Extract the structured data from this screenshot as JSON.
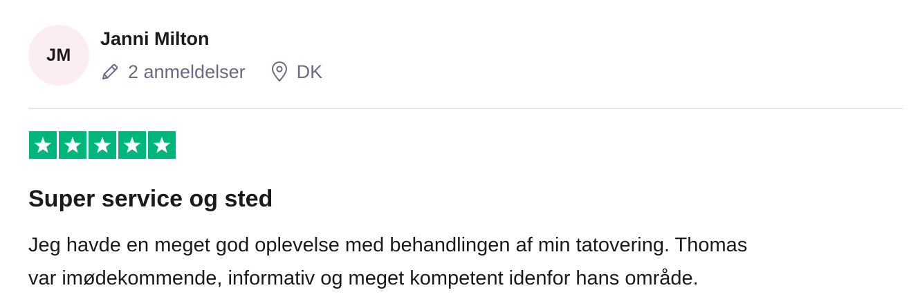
{
  "reviewer": {
    "initials": "JM",
    "name": "Janni Milton",
    "reviews_count": "2 anmeldelser",
    "country": "DK"
  },
  "rating": {
    "stars": 5,
    "max": 5,
    "color": "#00b67a"
  },
  "review": {
    "title": "Super service og sted",
    "body_lines": [
      "Jeg havde en meget god oplevelse med behandlingen af min tatovering. Thomas",
      "var imødekommende, informativ og meget kompetent idenfor hans område."
    ]
  },
  "icons": {
    "reviews": "pencil-icon",
    "location": "location-pin-icon",
    "star": "star-icon"
  }
}
